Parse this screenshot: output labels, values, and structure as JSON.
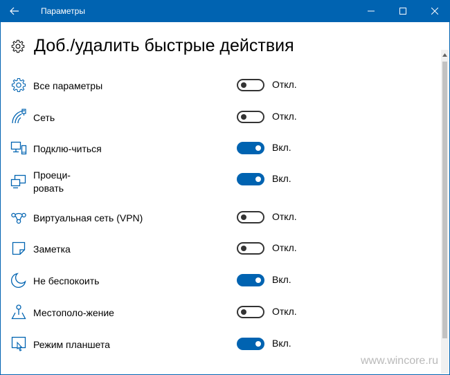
{
  "window": {
    "title": "Параметры"
  },
  "page": {
    "title": "Доб./удалить быстрые действия"
  },
  "actions": [
    {
      "label": "Все параметры",
      "state_label": "Откл.",
      "on": false,
      "icon": "gear-icon"
    },
    {
      "label": "Сеть",
      "state_label": "Откл.",
      "on": false,
      "icon": "network-icon"
    },
    {
      "label": "Подклю-читься",
      "state_label": "Вкл.",
      "on": true,
      "icon": "connect-icon"
    },
    {
      "label": "Проеци-\nровать",
      "state_label": "Вкл.",
      "on": true,
      "icon": "project-icon"
    },
    {
      "label": "Виртуальная сеть (VPN)",
      "state_label": "Откл.",
      "on": false,
      "icon": "vpn-icon"
    },
    {
      "label": "Заметка",
      "state_label": "Откл.",
      "on": false,
      "icon": "note-icon"
    },
    {
      "label": "Не беспокоить",
      "state_label": "Вкл.",
      "on": true,
      "icon": "moon-icon"
    },
    {
      "label": "Местополо-жение",
      "state_label": "Откл.",
      "on": false,
      "icon": "location-icon"
    },
    {
      "label": "Режим планшета",
      "state_label": "Вкл.",
      "on": true,
      "icon": "tablet-mode-icon"
    }
  ],
  "watermark": "www.wincore.ru",
  "colors": {
    "accent": "#0063b1",
    "toggle_off": "#333333",
    "text": "#000000"
  }
}
